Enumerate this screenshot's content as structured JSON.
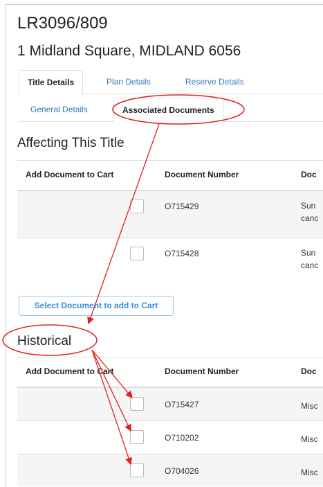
{
  "header": {
    "title": "LR3096/809",
    "address": "1 Midland Square, MIDLAND 6056"
  },
  "tabs_primary": [
    "Title Details",
    "Plan Details",
    "Reserve Details"
  ],
  "tabs_secondary": [
    "General Details",
    "Associated Documents"
  ],
  "affecting": {
    "heading": "Affecting This Title",
    "columns": [
      "Add Document to Cart",
      "Document Number",
      "Doc"
    ],
    "rows": [
      {
        "doc_number": "O715429",
        "desc_line1": "Sun",
        "desc_line2": "canc"
      },
      {
        "doc_number": "O715428",
        "desc_line1": "Sun",
        "desc_line2": "canc"
      }
    ],
    "button_label": "Select Document to add to Cart"
  },
  "historical": {
    "heading": "Historical",
    "columns": [
      "Add Document to Cart",
      "Document Number",
      "Doc"
    ],
    "rows": [
      {
        "doc_number": "O715427",
        "desc": "Misc"
      },
      {
        "doc_number": "O710202",
        "desc": "Misc"
      },
      {
        "doc_number": "O704026",
        "desc": "Misc"
      }
    ]
  },
  "colors": {
    "link": "#337ab7",
    "annotation": "#e02020"
  }
}
